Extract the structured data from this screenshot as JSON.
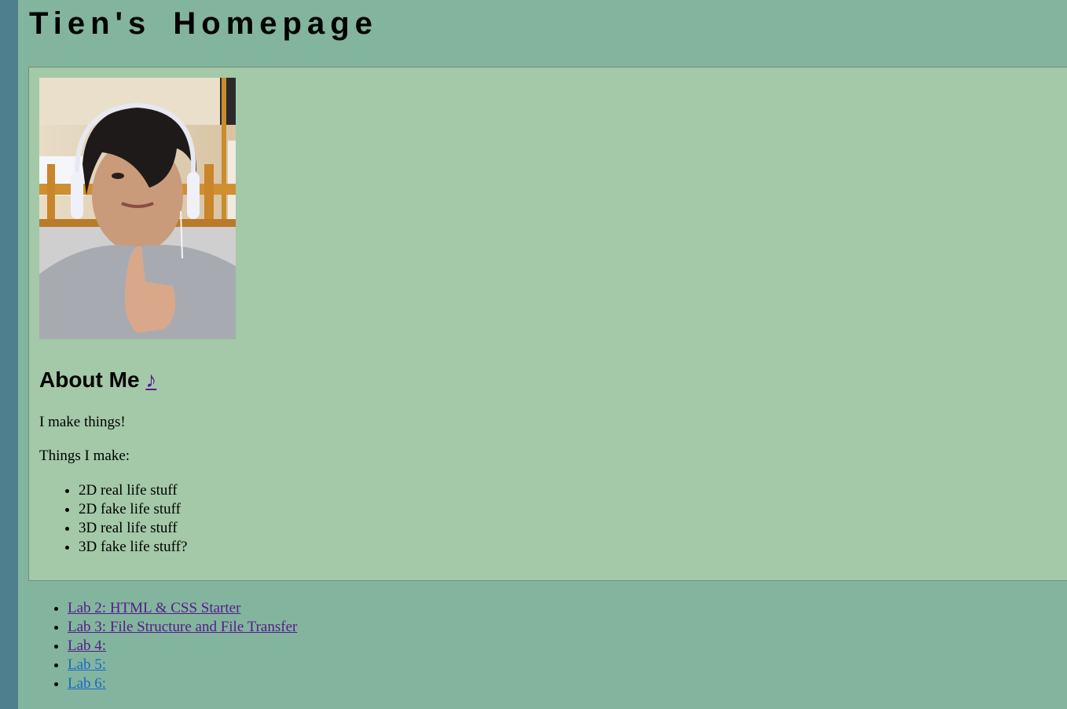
{
  "header": {
    "title": "Tien's Homepage"
  },
  "about": {
    "heading": "About Me",
    "music_link": "♪",
    "intro": "I make things!",
    "things_label": "Things I make:",
    "things": [
      "2D real life stuff",
      "2D fake life stuff",
      "3D real life stuff",
      "3D fake life stuff?"
    ]
  },
  "labs": [
    {
      "label": "Lab 2: HTML & CSS Starter",
      "visited": true
    },
    {
      "label": "Lab 3: File Structure and File Transfer",
      "visited": true
    },
    {
      "label": "Lab 4:",
      "visited": true
    },
    {
      "label": "Lab 5:",
      "visited": false
    },
    {
      "label": "Lab 6:",
      "visited": false
    }
  ],
  "colors": {
    "background": "#83b59e",
    "content_box": "#a3c9a8",
    "left_stripe": "#4e7f8f",
    "visited_link": "#551a8b",
    "link": "#1a66c8"
  }
}
